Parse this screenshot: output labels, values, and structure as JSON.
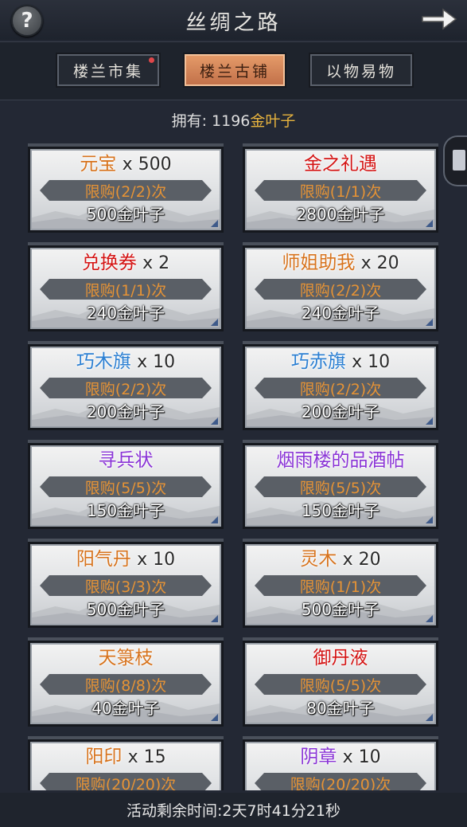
{
  "header": {
    "title": "丝绸之路",
    "help_icon": "help-question-icon",
    "next_icon": "arrow-right-icon"
  },
  "tabs": [
    {
      "label": "楼兰市集",
      "active": false,
      "badge": true
    },
    {
      "label": "楼兰古铺",
      "active": true,
      "badge": false
    },
    {
      "label": "以物易物",
      "active": false,
      "badge": false
    }
  ],
  "owned": {
    "label": "拥有:",
    "amount": "1196",
    "currency": "金叶子"
  },
  "colors": {
    "orange": "#d7731d",
    "red": "#d41414",
    "blue": "#2b7fd2",
    "purple": "#8a34d6",
    "gold": "#e6b23e"
  },
  "items": [
    {
      "name": "元宝",
      "qty": "x 500",
      "color": "orange",
      "limit": "限购(2/2)次",
      "price": "500金叶子"
    },
    {
      "name": "金之礼遇",
      "qty": "",
      "color": "red",
      "limit": "限购(1/1)次",
      "price": "2800金叶子"
    },
    {
      "name": "兑换券",
      "qty": "x 2",
      "color": "red",
      "limit": "限购(1/1)次",
      "price": "240金叶子"
    },
    {
      "name": "师姐助我",
      "qty": "x 20",
      "color": "orange",
      "limit": "限购(2/2)次",
      "price": "240金叶子"
    },
    {
      "name": "巧木旗",
      "qty": "x 10",
      "color": "blue",
      "limit": "限购(2/2)次",
      "price": "200金叶子"
    },
    {
      "name": "巧赤旗",
      "qty": "x 10",
      "color": "blue",
      "limit": "限购(2/2)次",
      "price": "200金叶子"
    },
    {
      "name": "寻兵状",
      "qty": "",
      "color": "purple",
      "limit": "限购(5/5)次",
      "price": "150金叶子"
    },
    {
      "name": "烟雨楼的品酒帖",
      "qty": "",
      "color": "purple",
      "limit": "限购(5/5)次",
      "price": "150金叶子"
    },
    {
      "name": "阳气丹",
      "qty": "x 10",
      "color": "orange",
      "limit": "限购(3/3)次",
      "price": "500金叶子"
    },
    {
      "name": "灵木",
      "qty": "x 20",
      "color": "orange",
      "limit": "限购(1/1)次",
      "price": "500金叶子"
    },
    {
      "name": "天箓枝",
      "qty": "",
      "color": "orange",
      "limit": "限购(8/8)次",
      "price": "40金叶子"
    },
    {
      "name": "御丹液",
      "qty": "",
      "color": "red",
      "limit": "限购(5/5)次",
      "price": "80金叶子"
    },
    {
      "name": "阳印",
      "qty": "x 15",
      "color": "orange",
      "limit": "限购(20/20)次",
      "price": ""
    },
    {
      "name": "阴章",
      "qty": "x 10",
      "color": "purple",
      "limit": "限购(20/20)次",
      "price": ""
    }
  ],
  "footer": {
    "countdown": "活动剩余时间:2天7时41分21秒"
  }
}
